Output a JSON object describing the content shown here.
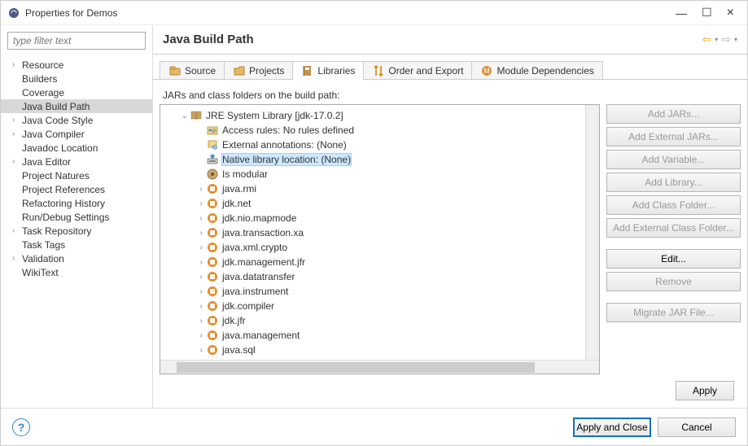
{
  "window": {
    "title": "Properties for Demos"
  },
  "filter": {
    "placeholder": "type filter text"
  },
  "nav": [
    {
      "label": "Resource",
      "expandable": true
    },
    {
      "label": "Builders",
      "expandable": false
    },
    {
      "label": "Coverage",
      "expandable": false
    },
    {
      "label": "Java Build Path",
      "expandable": false,
      "selected": true
    },
    {
      "label": "Java Code Style",
      "expandable": true
    },
    {
      "label": "Java Compiler",
      "expandable": true
    },
    {
      "label": "Javadoc Location",
      "expandable": false
    },
    {
      "label": "Java Editor",
      "expandable": true
    },
    {
      "label": "Project Natures",
      "expandable": false
    },
    {
      "label": "Project References",
      "expandable": false
    },
    {
      "label": "Refactoring History",
      "expandable": false
    },
    {
      "label": "Run/Debug Settings",
      "expandable": false
    },
    {
      "label": "Task Repository",
      "expandable": true
    },
    {
      "label": "Task Tags",
      "expandable": false
    },
    {
      "label": "Validation",
      "expandable": true
    },
    {
      "label": "WikiText",
      "expandable": false
    }
  ],
  "header": {
    "title": "Java Build Path"
  },
  "tabs": [
    {
      "label": "Source",
      "icon": "folder"
    },
    {
      "label": "Projects",
      "icon": "folder-open"
    },
    {
      "label": "Libraries",
      "icon": "book",
      "active": true
    },
    {
      "label": "Order and Export",
      "icon": "order"
    },
    {
      "label": "Module Dependencies",
      "icon": "module"
    }
  ],
  "jars_label": "JARs and class folders on the build path:",
  "lib_root": {
    "label": "JRE System Library [jdk-17.0.2]",
    "children": [
      {
        "label": "Access rules: No rules defined",
        "icon": "access"
      },
      {
        "label": "External annotations: (None)",
        "icon": "ext"
      },
      {
        "label": "Native library location: (None)",
        "icon": "native",
        "selected": true
      },
      {
        "label": "Is modular",
        "icon": "mod"
      }
    ],
    "packages": [
      "java.rmi",
      "jdk.net",
      "jdk.nio.mapmode",
      "java.transaction.xa",
      "java.xml.crypto",
      "jdk.management.jfr",
      "java.datatransfer",
      "java.instrument",
      "jdk.compiler",
      "jdk.jfr",
      "java.management",
      "java.sql"
    ]
  },
  "buttons": {
    "add_jars": "Add JARs...",
    "add_ext_jars": "Add External JARs...",
    "add_variable": "Add Variable...",
    "add_library": "Add Library...",
    "add_class_folder": "Add Class Folder...",
    "add_ext_class_folder": "Add External Class Folder...",
    "edit": "Edit...",
    "remove": "Remove",
    "migrate": "Migrate JAR File..."
  },
  "apply": "Apply",
  "footer": {
    "apply_close": "Apply and Close",
    "cancel": "Cancel"
  }
}
